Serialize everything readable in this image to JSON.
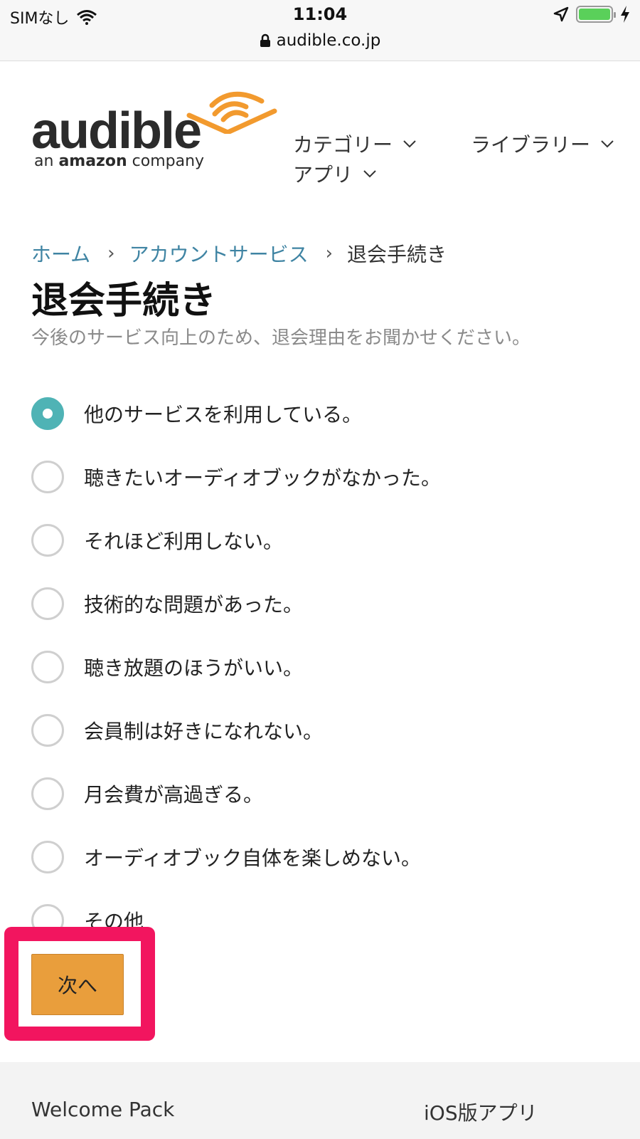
{
  "status_bar": {
    "carrier": "SIMなし",
    "time": "11:04",
    "url": "audible.co.jp",
    "battery_level": 1.0
  },
  "header": {
    "logo_word": "audible",
    "logo_sub_prefix": "an",
    "logo_sub_brand": "amazon",
    "logo_sub_suffix": "company",
    "nav": {
      "category": "カテゴリー",
      "library": "ライブラリー",
      "apps": "アプリ"
    }
  },
  "breadcrumb": {
    "home": "ホーム",
    "account": "アカウントサービス",
    "current": "退会手続き"
  },
  "page": {
    "title": "退会手続き",
    "description": "今後のサービス向上のため、退会理由をお聞かせください。"
  },
  "options": [
    {
      "label": "他のサービスを利用している。",
      "checked": true
    },
    {
      "label": "聴きたいオーディオブックがなかった。",
      "checked": false
    },
    {
      "label": "それほど利用しない。",
      "checked": false
    },
    {
      "label": "技術的な問題があった。",
      "checked": false
    },
    {
      "label": "聴き放題のほうがいい。",
      "checked": false
    },
    {
      "label": "会員制は好きになれない。",
      "checked": false
    },
    {
      "label": "月会費が高過ぎる。",
      "checked": false
    },
    {
      "label": "オーディオブック自体を楽しめない。",
      "checked": false
    },
    {
      "label": "その他",
      "checked": false
    }
  ],
  "next_button": "次へ",
  "footer": {
    "welcome_pack": "Welcome Pack",
    "ios_app": "iOS版アプリ"
  },
  "colors": {
    "accent_teal": "#4fb3b5",
    "button_orange": "#e99e3c",
    "highlight_pink": "#f2155f",
    "link_blue": "#3f84a3",
    "logo_orange": "#f29a2e"
  }
}
